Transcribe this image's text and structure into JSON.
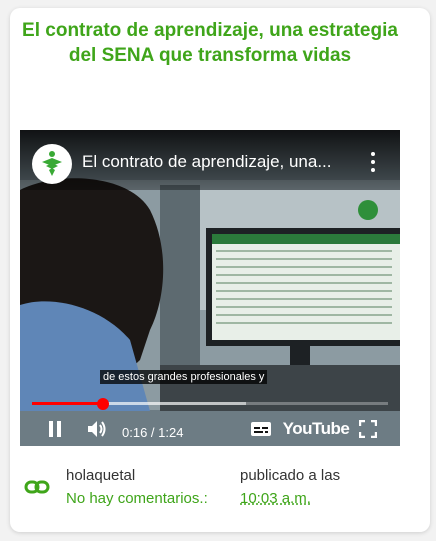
{
  "post": {
    "title": "El contrato de aprendizaje, una estrategia del SENA que transforma vidas",
    "author": "holaquetal",
    "comments": "No hay comentarios.:",
    "published_label": "publicado a las",
    "published_time": "10:03 a.m."
  },
  "video": {
    "title": "El contrato de aprendizaje, una...",
    "caption": "de estos grandes profesionales y",
    "current_time": "0:16 / 1:24",
    "brand": "YouTube",
    "played_fraction": 0.2,
    "buffered_fraction": 0.6
  },
  "colors": {
    "accent": "#3fa51a",
    "progress": "#ff0000"
  },
  "icons": {
    "channel_logo": "sena-logo-icon",
    "menu": "more-vert-icon",
    "pause": "pause-icon",
    "volume": "volume-icon",
    "captions": "captions-icon",
    "fullscreen": "fullscreen-icon",
    "permalink": "link-icon"
  }
}
